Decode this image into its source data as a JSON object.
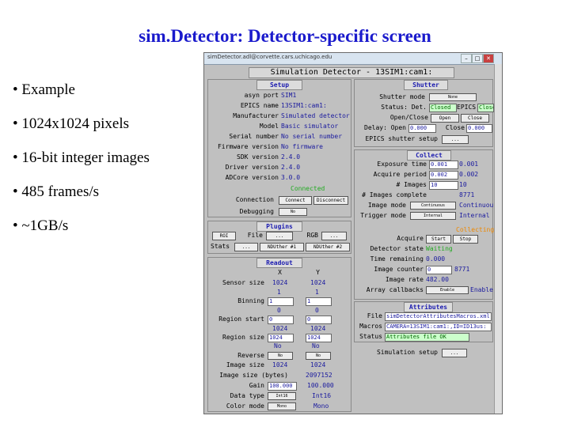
{
  "slide": {
    "title": "sim.Detector: Detector-specific screen",
    "bullets": [
      "• Example",
      "• 1024x1024 pixels",
      "• 16-bit integer images",
      "• 485 frames/s",
      "• ~1GB/s"
    ]
  },
  "window": {
    "title": "simDetector.adl@corvette.cars.uchicago.edu",
    "banner": "Simulation Detector - 13SIM1:cam1:",
    "controls": {
      "minimize": "–",
      "maximize": "□",
      "close": "✕"
    }
  },
  "setup": {
    "title": "Setup",
    "asyn_port": {
      "label": "asyn port",
      "value": "SIM1"
    },
    "epics_name": {
      "label": "EPICS name",
      "value": "13SIM1:cam1:"
    },
    "manufacturer": {
      "label": "Manufacturer",
      "value": "Simulated detector"
    },
    "model": {
      "label": "Model",
      "value": "Basic simulator"
    },
    "serial": {
      "label": "Serial number",
      "value": "No serial number"
    },
    "firmware": {
      "label": "Firmware version",
      "value": "No firmware"
    },
    "sdk": {
      "label": "SDK version",
      "value": "2.4.0"
    },
    "driver": {
      "label": "Driver version",
      "value": "2.4.0"
    },
    "adcore": {
      "label": "ADCore version",
      "value": "3.0.0"
    },
    "status": "Connected",
    "connection": {
      "label": "Connection",
      "connect": "Connect",
      "disconnect": "Disconnect"
    },
    "debugging": {
      "label": "Debugging",
      "value": "No"
    }
  },
  "shutter": {
    "title": "Shutter",
    "mode": {
      "label": "Shutter mode",
      "value": "None"
    },
    "status": {
      "label": "Status: Det.",
      "det_value": "Closed",
      "epics_label": "EPICS",
      "epics_value": "Closed"
    },
    "open_close": {
      "label": "Open/Close",
      "open": "Open",
      "close": "Close"
    },
    "delay": {
      "label": "Delay: Open",
      "open_value": "0.000",
      "close_label": "Close",
      "close_value": "0.000"
    },
    "epics_setup": {
      "label": "EPICS shutter setup",
      "button": "..."
    }
  },
  "collect": {
    "title": "Collect",
    "exposure": {
      "label": "Exposure time",
      "input": "0.001",
      "readback": "0.001"
    },
    "period": {
      "label": "Acquire period",
      "input": "0.002",
      "readback": "0.002"
    },
    "num_images": {
      "label": "# Images",
      "input": "10",
      "readback": "10"
    },
    "complete": {
      "label": "# Images complete",
      "value": "8771"
    },
    "image_mode": {
      "label": "Image mode",
      "menu": "Continuous",
      "value": "Continuous"
    },
    "trigger": {
      "label": "Trigger mode",
      "menu": "Internal",
      "value": "Internal"
    },
    "collecting": "Collecting",
    "acquire": {
      "label": "Acquire",
      "start": "Start",
      "stop": "Stop"
    },
    "det_state": {
      "label": "Detector state",
      "value": "Waiting"
    },
    "remaining": {
      "label": "Time remaining",
      "value": "0.000"
    },
    "counter": {
      "label": "Image counter",
      "input": "0",
      "value": "8771"
    },
    "rate": {
      "label": "Image rate",
      "value": "482.00"
    },
    "callbacks": {
      "label": "Array callbacks",
      "menu": "Enable",
      "value": "Enable"
    }
  },
  "plugins": {
    "title": "Plugins",
    "roi": "ROI",
    "file_label": "File",
    "file_btn": "...",
    "rgb_label": "RGB",
    "rgb_btn": "...",
    "stats": "Stats",
    "stats_btn": "...",
    "nuther1": "NDUther #1",
    "nuther2": "NDUther #2"
  },
  "readout": {
    "title": "Readout",
    "col_x": "X",
    "col_y": "Y",
    "sensor": {
      "label": "Sensor size",
      "x": "1024",
      "y": "1024"
    },
    "binning": {
      "label": "Binning",
      "rb_x": "1",
      "rb_y": "1",
      "x": "1",
      "y": "1"
    },
    "region_start": {
      "label": "Region start",
      "rb_x": "0",
      "rb_y": "0",
      "x": "0",
      "y": "0"
    },
    "region_size": {
      "label": "Region size",
      "rb_x": "1024",
      "rb_y": "1024",
      "x": "1024",
      "y": "1024"
    },
    "reverse": {
      "label": "Reverse",
      "x_btn": "No",
      "y_btn": "No",
      "x": "No",
      "y": "No"
    },
    "image_size": {
      "label": "Image size",
      "x": "1024",
      "y": "1024"
    },
    "image_bytes": {
      "label": "Image size (bytes)",
      "value": "2097152"
    },
    "gain": {
      "label": "Gain",
      "input": "100.000",
      "value": "100.000"
    },
    "data_type": {
      "label": "Data type",
      "menu": "Int16",
      "value": "Int16"
    },
    "color_mode": {
      "label": "Color mode",
      "menu": "Mono",
      "value": "Mono"
    }
  },
  "attributes": {
    "title": "Attributes",
    "file": {
      "label": "File",
      "value": "simDetectorAttributesMacros.xml"
    },
    "macros": {
      "label": "Macros",
      "value": "CAMERA=13SIM1:cam1:,ID=ID13us:"
    },
    "status": {
      "label": "Status",
      "value": "Attributes file OK"
    }
  },
  "simulation": {
    "label": "Simulation setup",
    "button": "..."
  }
}
